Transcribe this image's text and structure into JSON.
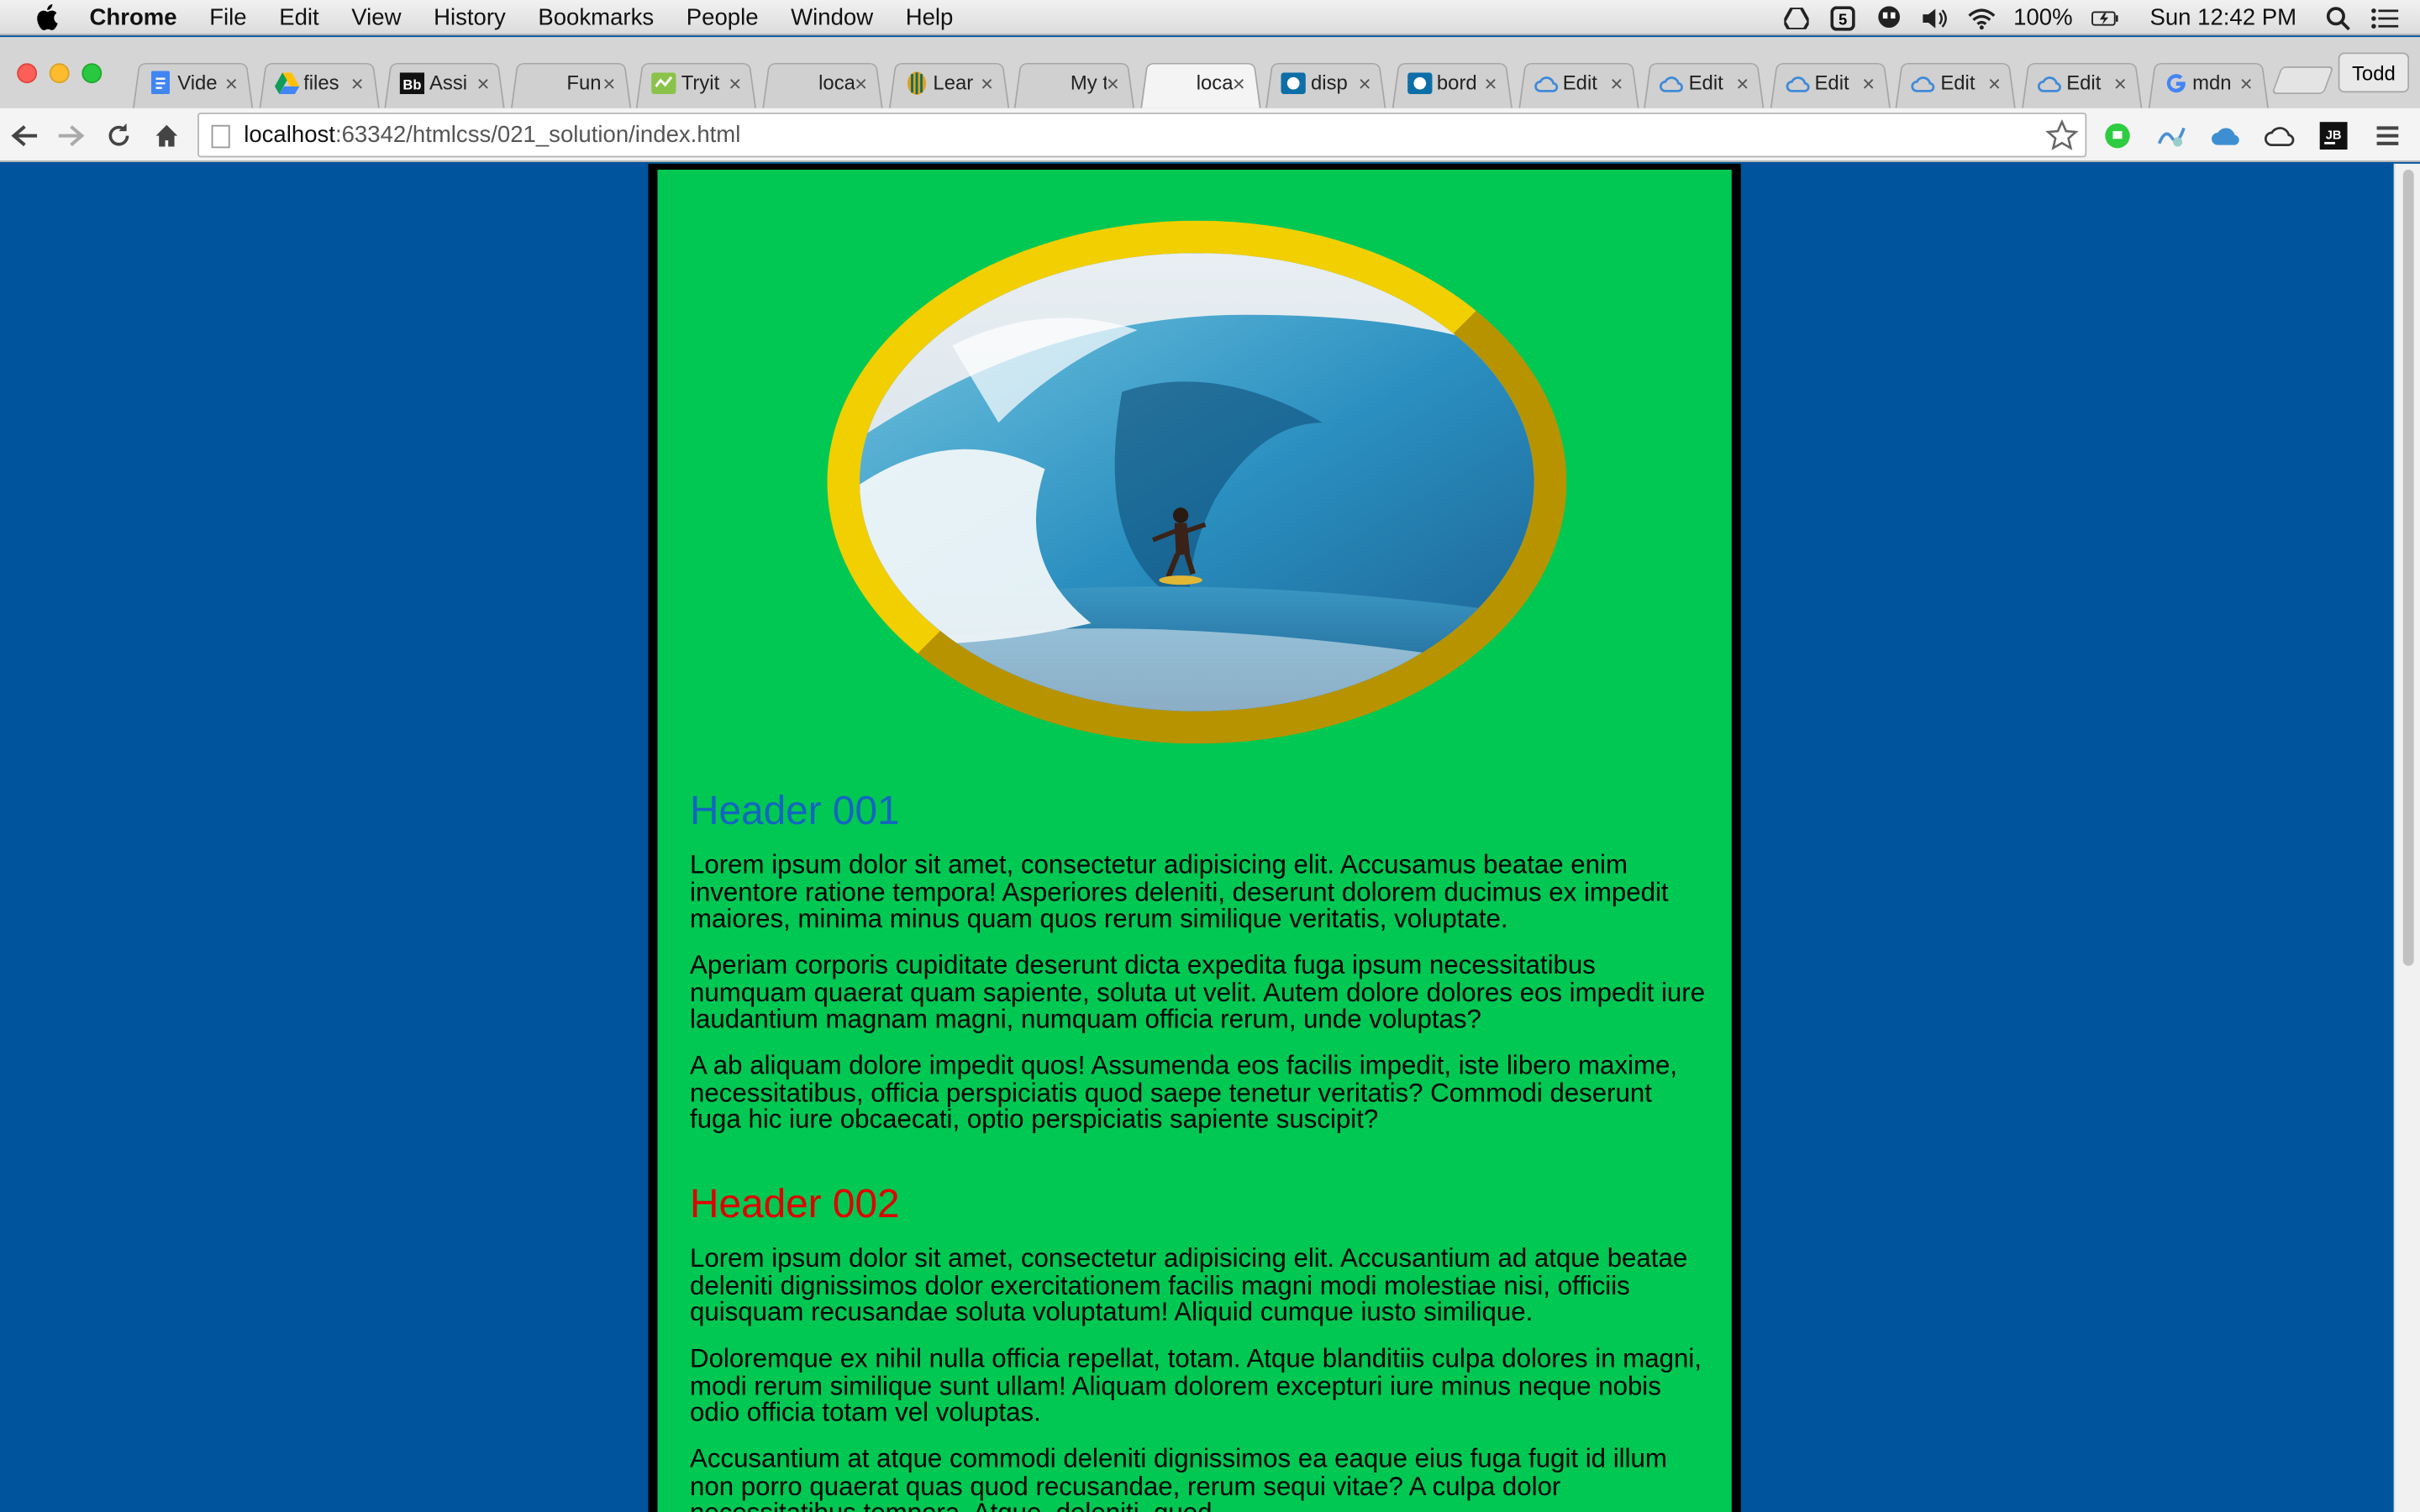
{
  "menubar": {
    "app_name": "Chrome",
    "items": [
      "File",
      "Edit",
      "View",
      "History",
      "Bookmarks",
      "People",
      "Window",
      "Help"
    ],
    "battery": "100%",
    "clock": "Sun 12:42 PM"
  },
  "tabs": [
    {
      "title": "Vide",
      "icon": "docs-icon",
      "active": false
    },
    {
      "title": "files",
      "icon": "drive-icon",
      "active": false
    },
    {
      "title": "Assi",
      "icon": "blackboard-icon",
      "active": false
    },
    {
      "title": "Fun",
      "icon": "none",
      "active": false
    },
    {
      "title": "Tryit",
      "icon": "tryit-icon",
      "active": false
    },
    {
      "title": "loca",
      "icon": "none",
      "active": false
    },
    {
      "title": "Lear",
      "icon": "lynda-icon",
      "active": false
    },
    {
      "title": "My t",
      "icon": "none",
      "active": false
    },
    {
      "title": "loca",
      "icon": "none",
      "active": true
    },
    {
      "title": "disp",
      "icon": "mdn-icon",
      "active": false
    },
    {
      "title": "bord",
      "icon": "mdn-icon",
      "active": false
    },
    {
      "title": "Edit",
      "icon": "cloud-icon",
      "active": false
    },
    {
      "title": "Edit",
      "icon": "cloud-icon",
      "active": false
    },
    {
      "title": "Edit",
      "icon": "cloud-icon",
      "active": false
    },
    {
      "title": "Edit",
      "icon": "cloud-icon",
      "active": false
    },
    {
      "title": "Edit",
      "icon": "cloud-icon",
      "active": false
    },
    {
      "title": "mdn",
      "icon": "google-icon",
      "active": false
    }
  ],
  "profile_name": "Todd",
  "address": {
    "host": "localhost",
    "rest": ":63342/htmlcss/021_solution/index.html"
  },
  "colors": {
    "page_bg": "#00539d",
    "container_bg": "#00c853",
    "border_gold": "#f2cf00",
    "border_dark_gold": "#b89300",
    "header1": "#1565c0",
    "header2": "#e00000"
  },
  "content": {
    "header1": "Header 001",
    "header1_paragraphs": [
      "Lorem ipsum dolor sit amet, consectetur adipisicing elit. Accusamus beatae enim inventore ratione tempora! Asperiores deleniti, deserunt dolorem ducimus ex impedit maiores, minima minus quam quos rerum similique veritatis, voluptate.",
      "Aperiam corporis cupiditate deserunt dicta expedita fuga ipsum necessitatibus numquam quaerat quam sapiente, soluta ut velit. Autem dolore dolores eos impedit iure laudantium magnam magni, numquam officia rerum, unde voluptas?",
      "A ab aliquam dolore impedit quos! Assumenda eos facilis impedit, iste libero maxime, necessitatibus, officia perspiciatis quod saepe tenetur veritatis? Commodi deserunt fuga hic iure obcaecati, optio perspiciatis sapiente suscipit?"
    ],
    "header2": "Header 002",
    "header2_paragraphs": [
      "Lorem ipsum dolor sit amet, consectetur adipisicing elit. Accusantium ad atque beatae deleniti dignissimos dolor exercitationem facilis magni modi molestiae nisi, officiis quisquam recusandae soluta voluptatum! Aliquid cumque iusto similique.",
      "Doloremque ex nihil nulla officia repellat, totam. Atque blanditiis culpa dolores in magni, modi rerum similique sunt ullam! Aliquam dolorem excepturi iure minus neque nobis odio officia totam vel voluptas.",
      "Accusantium at atque commodi deleniti dignissimos ea eaque eius fuga fugit id illum non porro quaerat quas quod recusandae, rerum sequi vitae? A culpa dolor necessitatibus tempora. Atque, deleniti, quod"
    ]
  }
}
